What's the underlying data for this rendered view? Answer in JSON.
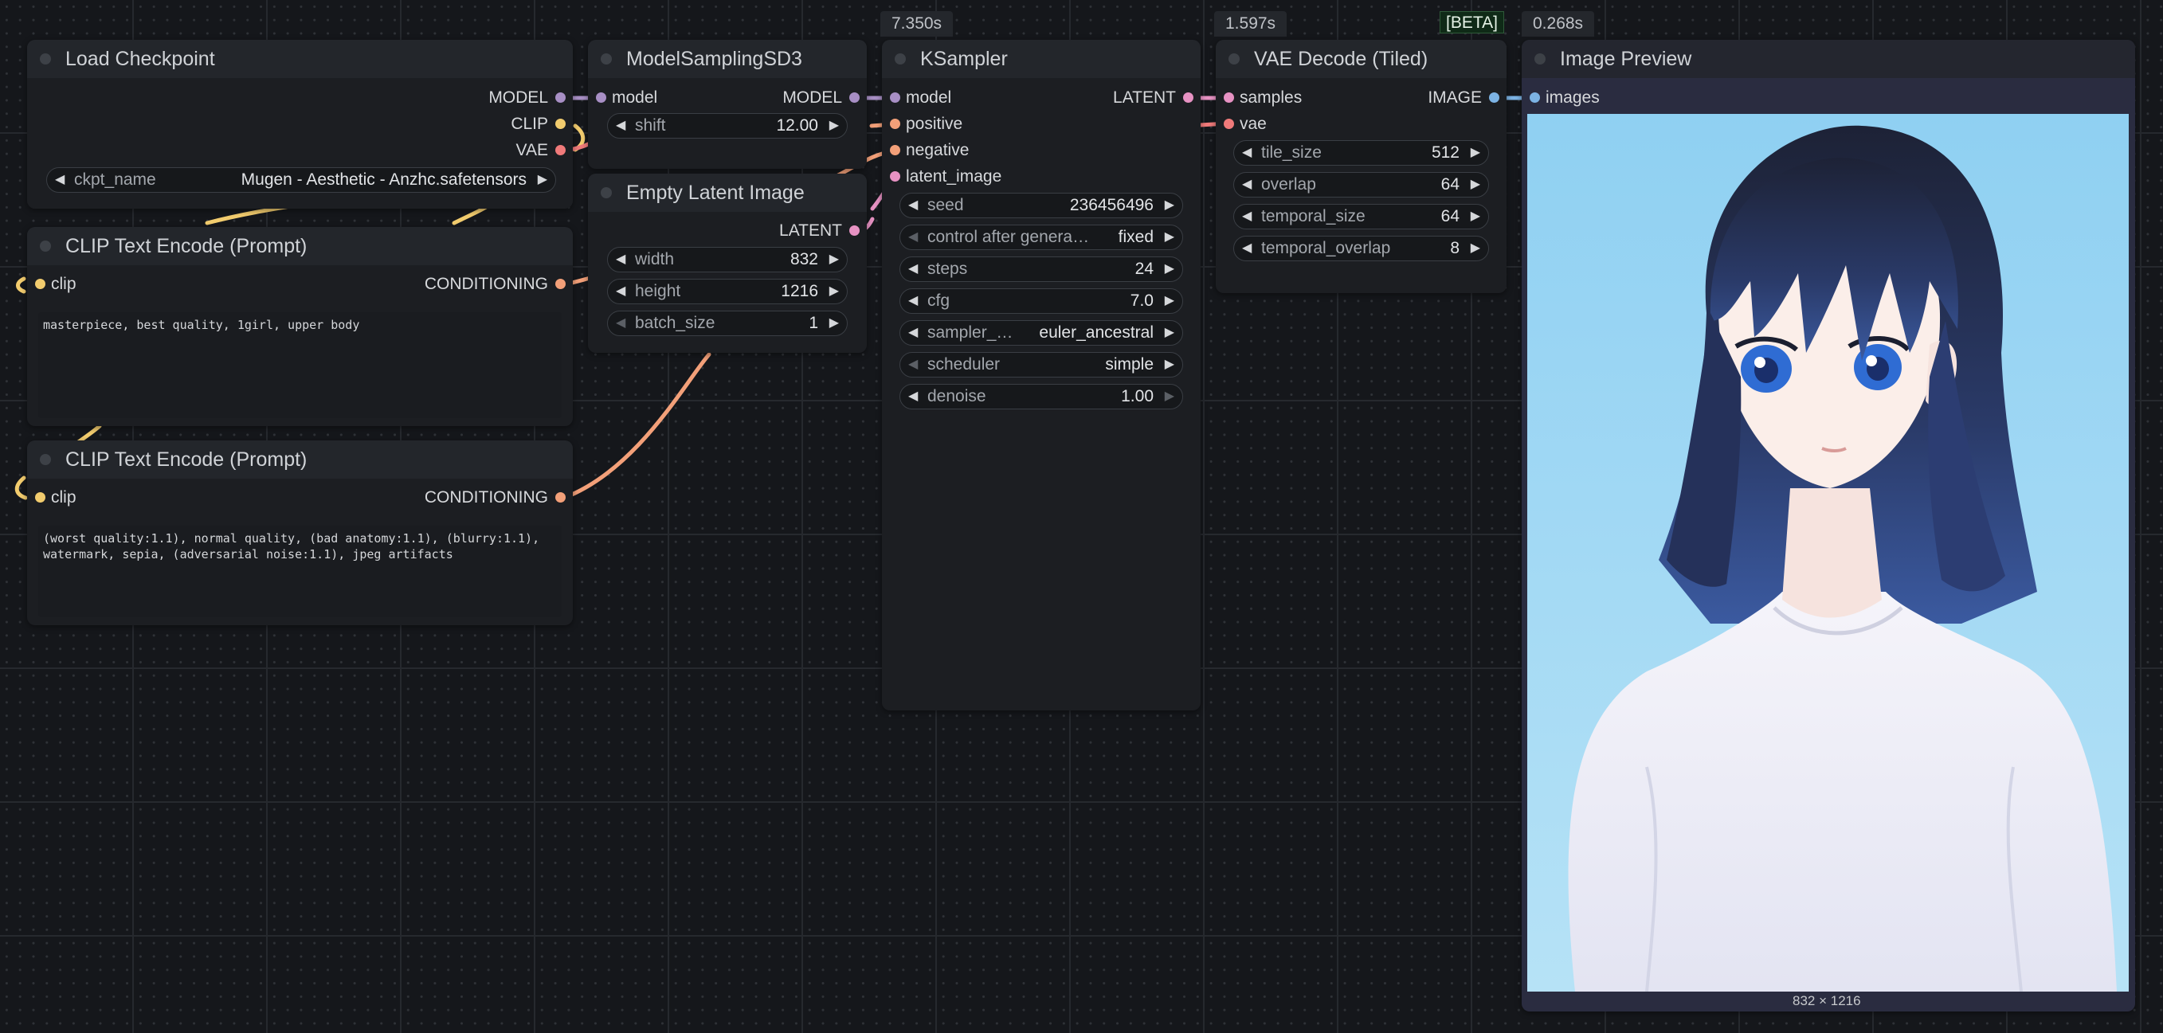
{
  "timings": {
    "ksampler": "7.350s",
    "vae_decode": "1.597s",
    "beta_badge": "[BETA]",
    "preview": "0.268s"
  },
  "load_checkpoint": {
    "title": "Load Checkpoint",
    "outputs": [
      "MODEL",
      "CLIP",
      "VAE"
    ],
    "ckpt_label": "ckpt_name",
    "ckpt_value": "Mugen - Aesthetic - Anzhc.safetensors"
  },
  "model_sampling": {
    "title": "ModelSamplingSD3",
    "input": "model",
    "output": "MODEL",
    "shift_label": "shift",
    "shift_value": "12.00"
  },
  "empty_latent": {
    "title": "Empty Latent Image",
    "output": "LATENT",
    "width_label": "width",
    "width_value": "832",
    "height_label": "height",
    "height_value": "1216",
    "batch_label": "batch_size",
    "batch_value": "1"
  },
  "clip_pos": {
    "title": "CLIP Text Encode (Prompt)",
    "input": "clip",
    "output": "CONDITIONING",
    "text": "masterpiece, best quality, 1girl, upper body"
  },
  "clip_neg": {
    "title": "CLIP Text Encode (Prompt)",
    "input": "clip",
    "output": "CONDITIONING",
    "text": "(worst quality:1.1), normal quality, (bad anatomy:1.1), (blurry:1.1),\nwatermark, sepia, (adversarial noise:1.1), jpeg artifacts"
  },
  "ksampler": {
    "title": "KSampler",
    "inputs": [
      "model",
      "positive",
      "negative",
      "latent_image"
    ],
    "output": "LATENT",
    "seed_label": "seed",
    "seed_value": "236456496",
    "control_label": "control after genera…",
    "control_value": "fixed",
    "steps_label": "steps",
    "steps_value": "24",
    "cfg_label": "cfg",
    "cfg_value": "7.0",
    "sampler_label": "sampler_…",
    "sampler_value": "euler_ancestral",
    "scheduler_label": "scheduler",
    "scheduler_value": "simple",
    "denoise_label": "denoise",
    "denoise_value": "1.00"
  },
  "vae_decode": {
    "title": "VAE Decode (Tiled)",
    "inputs": [
      "samples",
      "vae"
    ],
    "output": "IMAGE",
    "tile_label": "tile_size",
    "tile_value": "512",
    "overlap_label": "overlap",
    "overlap_value": "64",
    "temporal_label": "temporal_size",
    "temporal_value": "64",
    "toverlap_label": "temporal_overlap",
    "toverlap_value": "8"
  },
  "preview": {
    "title": "Image Preview",
    "input": "images",
    "caption": "832 × 1216"
  },
  "colors": {
    "model": "#a88fc5",
    "clip": "#f2cc6e",
    "vae": "#f07a7a",
    "conditioning": "#f3a079",
    "latent": "#e792c3",
    "image": "#7cb3e4"
  }
}
